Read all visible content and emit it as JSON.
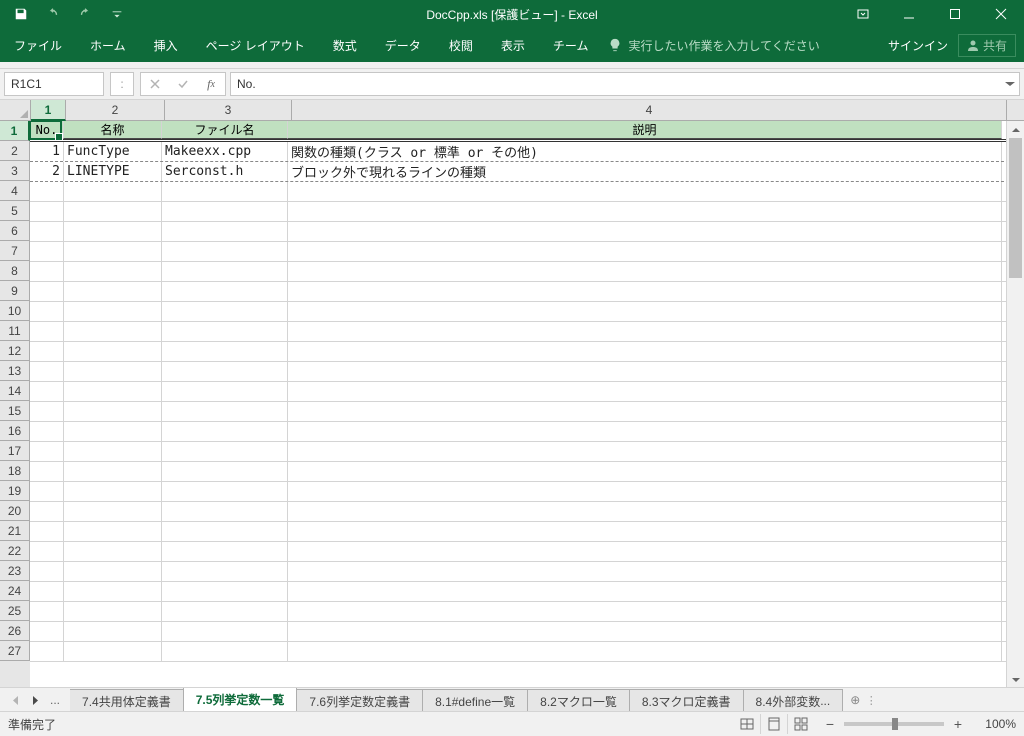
{
  "titlebar": {
    "title": "DocCpp.xls  [保護ビュー] - Excel"
  },
  "ribbon": {
    "tabs": [
      "ファイル",
      "ホーム",
      "挿入",
      "ページ レイアウト",
      "数式",
      "データ",
      "校閲",
      "表示",
      "チーム"
    ],
    "tell_me_placeholder": "実行したい作業を入力してください",
    "sign_in": "サインイン",
    "share": "共有"
  },
  "formulaBar": {
    "name_box": "R1C1",
    "formula": "No."
  },
  "columns": {
    "headers": [
      "1",
      "2",
      "3",
      "4"
    ]
  },
  "dataHeaders": {
    "A": "No.",
    "B": "名称",
    "C": "ファイル名",
    "D": "説明"
  },
  "rows": {
    "r2": {
      "A": "1",
      "B": "FuncType",
      "C": "Makeexx.cpp",
      "D": "関数の種類(クラス or 標準 or その他)"
    },
    "r3": {
      "A": "2",
      "B": "LINETYPE",
      "C": "Serconst.h",
      "D": "ブロック外で現れるラインの種類"
    }
  },
  "sheetTabs": {
    "tabs": [
      "7.4共用体定義書",
      "7.5列挙定数一覧",
      "7.6列挙定数定義書",
      "8.1#define一覧",
      "8.2マクロ一覧",
      "8.3マクロ定義書",
      "8.4外部変数"
    ],
    "active_index": 1
  },
  "statusBar": {
    "status": "準備完了",
    "zoom": "100%"
  }
}
